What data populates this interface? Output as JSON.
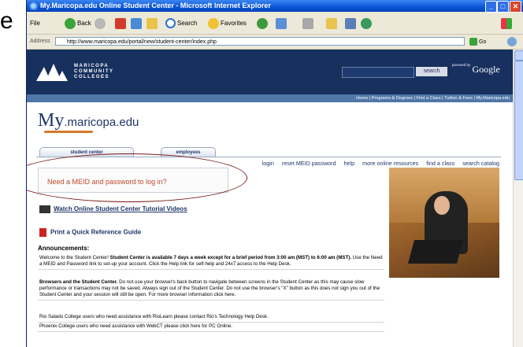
{
  "slide": {
    "letter": "e"
  },
  "window": {
    "title": "My.Maricopa.edu Online Student Center - Microsoft Internet Explorer",
    "controls": [
      "_",
      "□",
      "✕"
    ]
  },
  "toolbar": {
    "file": "File",
    "back": "Back",
    "search": "Search",
    "favorites": "Favorites"
  },
  "address": {
    "label": "Address",
    "url": "http://www.maricopa.edu/portal/new/student-center/index.php",
    "go": "Go"
  },
  "banner": {
    "org_line1": "MARICOPA",
    "org_line2": "COMMUNITY",
    "org_line3": "COLLEGES",
    "search_button": "search",
    "powered": "powered by",
    "google": "Google"
  },
  "nav": {
    "text": "Home  |  Programs & Degrees  |  Find a Class  |  Tuition & Fees  |  My.Maricopa.edu"
  },
  "portal": {
    "logo_my": "My",
    "logo_rest": ".maricopa.edu"
  },
  "tabs": {
    "student": "student center",
    "employees": "employees"
  },
  "links": [
    "login",
    "reset MEID password",
    "help",
    "more online resources",
    "find a class",
    "search catalog"
  ],
  "meid": {
    "prompt": "Need a MEID and password to log in?"
  },
  "resources": {
    "video": "Watch Online Student Center Tutorial Videos",
    "guide": "Print a Quick Reference Guide"
  },
  "announcements": {
    "title": "Announcements:",
    "items": [
      {
        "lead": "Welcome to the Student Center!",
        "bold": "Student Center is available 7 days a week except for a brief period from 3:00 am (MST) to 6:00 am (MST).",
        "rest": " Use the Need a MEID and Password link to set-up your account. Click the Help link for self-help and 24x7 access to the Help Desk."
      },
      {
        "lead": "Browsers and the Student Center.",
        "bold": "",
        "rest": " Do not use your browser's back button to navigate between screens in the Student Center as this may cause slow performance or transactions may not be saved. Always sign out of the Student Center. Do not use the browser's \"X\" button as this does not sign you out of the Student Center and your session will still be open. For more browser information click here."
      },
      {
        "lead": "",
        "bold": "",
        "rest": "Rio Salado College users who need assistance with RioLearn please contact Rio's Technology Help Desk."
      },
      {
        "lead": "",
        "bold": "",
        "rest": "Phoenix College users who need assistance with WebCT please click here for PC Online."
      }
    ]
  }
}
